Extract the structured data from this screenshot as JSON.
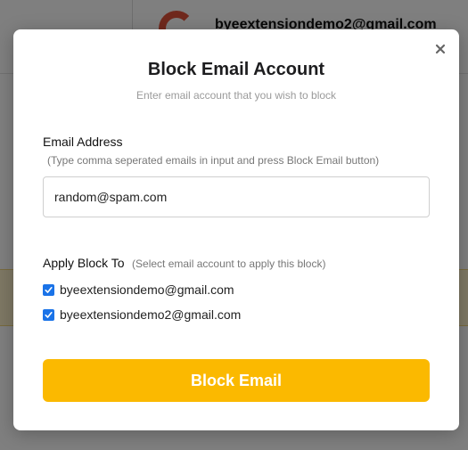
{
  "background": {
    "account_email": "byeextensiondemo2@gmail.com"
  },
  "modal": {
    "title": "Block Email Account",
    "subtitle": "Enter email account that you wish to block",
    "close_icon": "close-icon",
    "email_field": {
      "label": "Email Address",
      "hint": "(Type comma seperated emails in input and press Block Email button)",
      "value": "random@spam.com"
    },
    "apply_block": {
      "label": "Apply Block To",
      "hint": "(Select email account to apply this block)",
      "accounts": [
        {
          "email": "byeextensiondemo@gmail.com",
          "checked": true
        },
        {
          "email": "byeextensiondemo2@gmail.com",
          "checked": true
        }
      ]
    },
    "submit_label": "Block Email"
  },
  "colors": {
    "accent": "#fbb900",
    "checkbox": "#1a73e8",
    "overlay": "rgba(0,0,0,0.5)"
  }
}
